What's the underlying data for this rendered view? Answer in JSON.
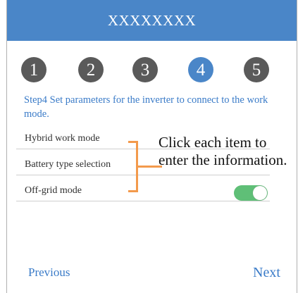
{
  "header": {
    "title": "XXXXXXXX"
  },
  "steps": [
    {
      "label": "1",
      "active": false
    },
    {
      "label": "2",
      "active": false
    },
    {
      "label": "3",
      "active": false
    },
    {
      "label": "4",
      "active": true
    },
    {
      "label": "5",
      "active": false
    }
  ],
  "instruction": "Step4 Set parameters for the inverter to connect to the work mode.",
  "fields": [
    {
      "label": "Hybrid work mode"
    },
    {
      "label": "Battery type selection"
    },
    {
      "label": "Off-grid mode"
    }
  ],
  "off_grid_toggle": {
    "on": true
  },
  "callout": "Click each item to enter the information.",
  "nav": {
    "previous_label": "Previous",
    "next_label": "Next"
  },
  "colors": {
    "header_bg": "#4a86c8",
    "step_inactive": "#5a5a5a",
    "step_active": "#4a86c8",
    "link": "#3a7bc8",
    "toggle_on": "#5fbf77",
    "annotation": "#f39a4c"
  }
}
